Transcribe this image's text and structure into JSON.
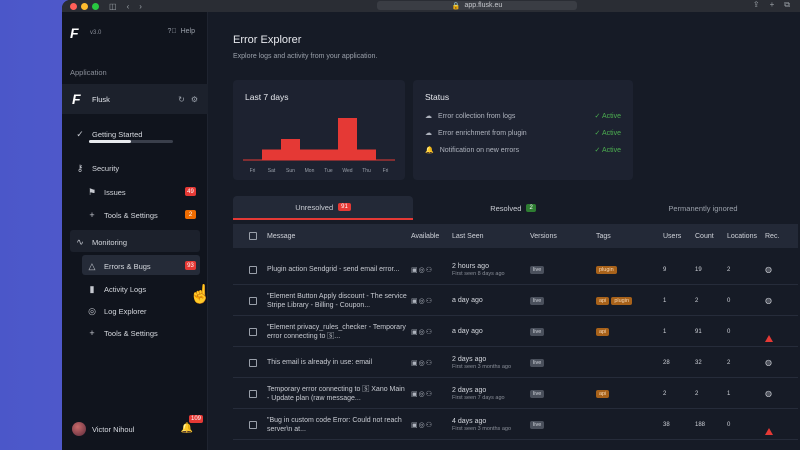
{
  "browser": {
    "url": "app.flusk.eu",
    "controls": [
      "◫",
      "‹",
      "›"
    ],
    "right_icons": [
      "⇪",
      "+",
      "⧉"
    ]
  },
  "sidebar": {
    "version": "v3.0",
    "help_label": "Help",
    "section_label": "Application",
    "app_name": "Flusk",
    "getting_started": {
      "label": "Getting Started",
      "progress": 0.5
    },
    "security_label": "Security",
    "issues": {
      "label": "Issues",
      "count": "49"
    },
    "tools_settings_1": {
      "label": "Tools & Settings",
      "count": "2"
    },
    "monitoring_label": "Monitoring",
    "errors_bugs": {
      "label": "Errors & Bugs",
      "count": "93"
    },
    "activity_label": "Activity Logs",
    "log_explorer_label": "Log Explorer",
    "tools_settings_2": {
      "label": "Tools & Settings"
    },
    "user_name": "Victor Nihoul",
    "notif_count": "109"
  },
  "main": {
    "title": "Error Explorer",
    "subtitle": "Explore logs and activity from your application.",
    "chart_card_title": "Last 7 days",
    "status_card_title": "Status",
    "status_items": [
      {
        "label": "Error collection from logs",
        "value": "Active"
      },
      {
        "label": "Error enrichment from plugin",
        "value": "Active"
      },
      {
        "label": "Notification on new errors",
        "value": "Active"
      }
    ],
    "tabs": [
      {
        "label": "Unresolved",
        "count": "91",
        "color": "#e53935"
      },
      {
        "label": "Resolved",
        "count": "2",
        "color": "#2e7d32"
      },
      {
        "label": "Permanently ignored",
        "count": ""
      }
    ],
    "columns": [
      "Message",
      "Available",
      "Last Seen",
      "Versions",
      "Tags",
      "Users",
      "Count",
      "Locations",
      "Rec."
    ],
    "rows": [
      {
        "message": "Plugin action Sendgrid - send email error...",
        "last_seen": "2 hours ago",
        "first_seen": "First seen 8 days ago",
        "versions": [
          "live"
        ],
        "tags": [
          "plugin"
        ],
        "users": "9",
        "count": "19",
        "locations": "2",
        "rec": "globe"
      },
      {
        "message": "\"Element Button Apply discount - The service Stripe Library - Billing - Coupon...",
        "last_seen": "a day ago",
        "first_seen": "",
        "versions": [
          "live"
        ],
        "tags": [
          "api",
          "plugin"
        ],
        "users": "1",
        "count": "2",
        "locations": "0",
        "rec": "globe"
      },
      {
        "message": "\"Element privacy_rules_checker - Temporary error connecting to 🅂...",
        "last_seen": "a day ago",
        "first_seen": "",
        "versions": [
          "live"
        ],
        "tags": [
          "api"
        ],
        "users": "1",
        "count": "91",
        "locations": "0",
        "rec": "red"
      },
      {
        "message": "This email is already in use: email",
        "last_seen": "2 days ago",
        "first_seen": "First seen 3 months ago",
        "versions": [
          "live"
        ],
        "tags": [],
        "users": "28",
        "count": "32",
        "locations": "2",
        "rec": "globe"
      },
      {
        "message": "Temporary error connecting to 🅂 Xano Main - Update plan (raw message...",
        "last_seen": "2 days ago",
        "first_seen": "First seen 7 days ago",
        "versions": [
          "live"
        ],
        "tags": [
          "api"
        ],
        "users": "2",
        "count": "2",
        "locations": "1",
        "rec": "globe"
      },
      {
        "message": "\"Bug in custom code Error: Could not reach server\\n    at...",
        "last_seen": "4 days ago",
        "first_seen": "First seen 3 months ago",
        "versions": [
          "live"
        ],
        "tags": [],
        "users": "38",
        "count": "188",
        "locations": "0",
        "rec": "red"
      }
    ]
  },
  "chart_data": {
    "type": "bar",
    "title": "Last 7 days",
    "categories": [
      "Fri",
      "Sat",
      "Sun",
      "Mon",
      "Tue",
      "Wed",
      "Thu",
      "Fri"
    ],
    "values": [
      0,
      2,
      4,
      2,
      2,
      8,
      2,
      0
    ],
    "colors": {
      "bar": "#e53935"
    }
  },
  "colors": {
    "accent": "#e53935",
    "active_status": "#4caf50"
  }
}
